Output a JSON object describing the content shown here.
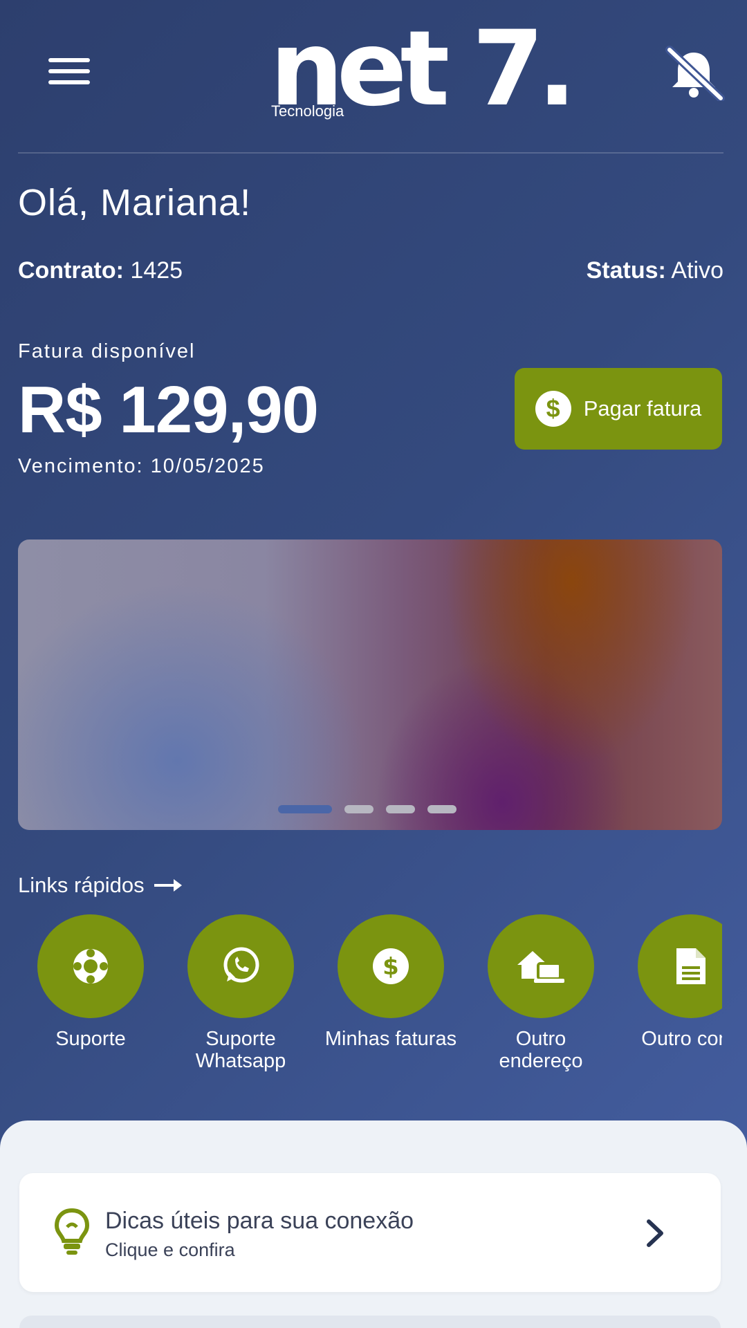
{
  "header": {
    "logo_text": "net 7.",
    "logo_subtitle": "Tecnologia",
    "menu_icon": "hamburger-menu-icon",
    "notification_icon": "bell-off-icon"
  },
  "greeting": "Olá, Mariana!",
  "contract": {
    "label": "Contrato:",
    "value": "1425",
    "status_label": "Status:",
    "status_value": "Ativo"
  },
  "invoice": {
    "label": "Fatura disponível",
    "amount": "R$ 129,90",
    "due": "Vencimento: 10/05/2025",
    "pay_label": "Pagar fatura",
    "pay_icon": "dollar-circle-icon"
  },
  "carousel": {
    "slide_count": 4,
    "active_index": 0
  },
  "quick_links": {
    "title": "Links rápidos",
    "arrow_icon": "arrow-right-icon",
    "items": [
      {
        "label": "Suporte",
        "icon": "lifebuoy-icon"
      },
      {
        "label": "Suporte\nWhatsapp",
        "icon": "whatsapp-icon"
      },
      {
        "label": "Minhas faturas",
        "icon": "dollar-circle-icon"
      },
      {
        "label": "Outro\nendereço",
        "icon": "house-laptop-icon"
      },
      {
        "label": "Outro contı",
        "icon": "document-icon"
      }
    ]
  },
  "tips": {
    "title": "Dicas úteis para sua conexão",
    "subtitle": "Clique e confira",
    "icon": "lightbulb-icon",
    "chevron_icon": "chevron-right-icon"
  },
  "colors": {
    "accent_green": "#7b9410",
    "background_blue": "#344a7e",
    "sheet_bg": "#eef2f7",
    "tips_text": "#3b4258"
  }
}
